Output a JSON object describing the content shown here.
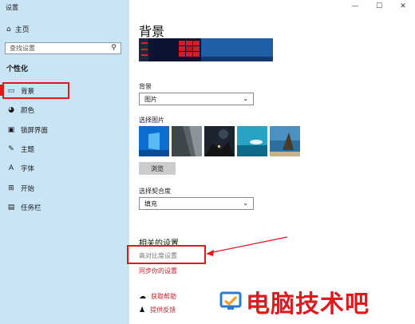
{
  "window": {
    "title": "设置",
    "controls": [
      "—",
      "☐",
      "✕"
    ]
  },
  "sidebar": {
    "home_label": "主页",
    "search_placeholder": "查找设置",
    "section_title": "个性化",
    "items": [
      {
        "label": "背景",
        "icon": "image-icon"
      },
      {
        "label": "颜色",
        "icon": "palette-icon"
      },
      {
        "label": "锁屏界面",
        "icon": "lockscreen-icon"
      },
      {
        "label": "主题",
        "icon": "theme-icon"
      },
      {
        "label": "字体",
        "icon": "font-icon"
      },
      {
        "label": "开始",
        "icon": "start-icon"
      },
      {
        "label": "任务栏",
        "icon": "taskbar-icon"
      }
    ]
  },
  "main": {
    "title": "背景",
    "background_label": "背景",
    "background_value": "图片",
    "choose_picture_label": "选择图片",
    "browse_label": "浏览",
    "fit_label": "选择契合度",
    "fit_value": "填充",
    "related_title": "相关的设置",
    "related_links": [
      "高对比度设置",
      "同步你的设置"
    ],
    "help_links": [
      "获取帮助",
      "提供反馈"
    ]
  },
  "watermark": {
    "text": "电脑技术吧"
  },
  "colors": {
    "sidebar_bg": "#c9e4f5",
    "accent_red": "#e0191d",
    "link_red": "#c41e25"
  }
}
